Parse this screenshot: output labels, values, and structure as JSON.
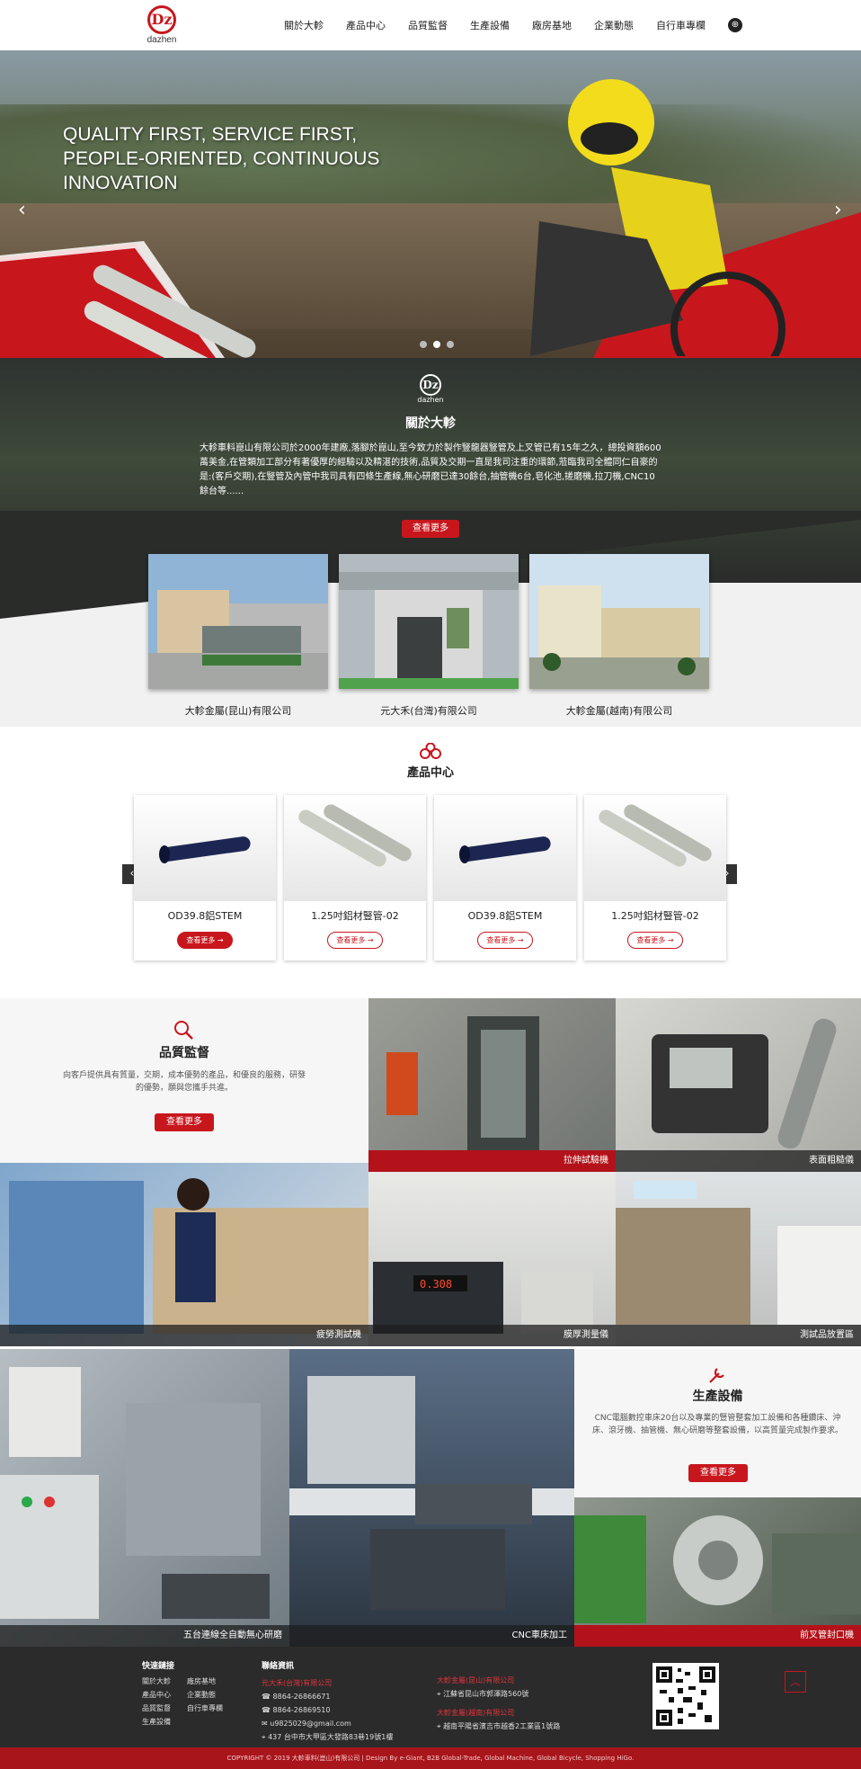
{
  "brand": {
    "logo_letters": "Dz",
    "logo_word": "dazhen"
  },
  "nav": {
    "items": [
      "關於大軫",
      "產品中心",
      "品質監督",
      "生產設備",
      "廠房基地",
      "企業動態",
      "自行車專欄"
    ],
    "language_icon": "globe-icon"
  },
  "hero": {
    "headline": "QUALITY FIRST, SERVICE FIRST, PEOPLE-ORIENTED, CONTINUOUS INNOVATION",
    "prev_glyph": "‹",
    "next_glyph": "›",
    "slide_count": 3,
    "active_slide": 2
  },
  "about": {
    "title": "關於大軫",
    "body": "大軫車料崑山有限公司於2000年建廠,落腳於崑山,至今致力於製作豎龍器豎管及上叉管已有15年之久，總投資額600萬美金,在管類加工部分有著優厚的經驗以及精湛的技術,品質及交期一直是我司注重的環節,蒞臨我司全體同仁自豪的是:(客戶交期),在豎管及內管中我司具有四條生產線,無心研磨已達30餘台,抽管機6台,皂化池,搓磨機,拉刀機,CNC10餘台等......",
    "more_label": "查看更多",
    "companies": [
      "大軫金屬(昆山)有限公司",
      "元大禾(台灣)有限公司",
      "大軫金屬(越南)有限公司"
    ]
  },
  "products": {
    "title": "產品中心",
    "prev_glyph": "‹",
    "next_glyph": "›",
    "items": [
      {
        "name": "OD39.8鋁STEM",
        "more": "查看更多 →"
      },
      {
        "name": "1.25吋鋁材豎管-02",
        "more": "查看更多 →"
      },
      {
        "name": "OD39.8鋁STEM",
        "more": "查看更多 →"
      },
      {
        "name": "1.25吋鋁材豎管-02",
        "more": "查看更多 →"
      }
    ]
  },
  "quality": {
    "title": "品質監督",
    "body": "向客戶提供具有質量，交期，成本優勢的產品，和優良的服務，研發的優勢，願與您攜手共進。",
    "more_label": "查看更多",
    "tiles": [
      "拉伸試驗機",
      "表面粗糙儀",
      "疲勞測試機",
      "膜厚測量儀",
      "測試品放置區"
    ]
  },
  "equipment": {
    "title": "生產設備",
    "body": "CNC電腦數控車床20台以及專業的豎管整套加工設備和各種鑽床、沖床、滾牙機、抽管機、無心研磨等整套設備，以高質量完成製作要求。",
    "more_label": "查看更多",
    "tiles": [
      "五台連線全自動無心研磨",
      "CNC車床加工",
      "前叉管封口機"
    ]
  },
  "footer": {
    "quick_links_title": "快速鏈接",
    "quick_links": [
      "關於大軫",
      "廠房基地",
      "產品中心",
      "企業動態",
      "品質監督",
      "自行車專欄",
      "生產設備"
    ],
    "contact_title": "聯絡資訊",
    "taiwan_company": "元大禾(台灣)有限公司",
    "phone": "8864-26866671",
    "fax": "8864-26869510",
    "email": "u9825029@gmail.com",
    "address": "437 台中市大甲區大發路83巷19號1樓",
    "kunshan_company": "大軫金屬(昆山)有限公司",
    "kunshan_address": "江蘇省昆山市郭澤路560號",
    "vietnam_company": "大軫金屬(越南)有限公司",
    "vietnam_address": "越南平陽省濱吉市越香2工業區1號路",
    "to_top_glyph": "︿",
    "copyright": "COPYRIGHT © 2019 大軫車料(崑山)有限公司 | Design By e-Giant, B2B Global-Trade, Global Machine, Global Bicycle, Shopping HiGo."
  },
  "colors": {
    "brand_red": "#c8161d",
    "footer_dark": "#2b2b2b"
  }
}
